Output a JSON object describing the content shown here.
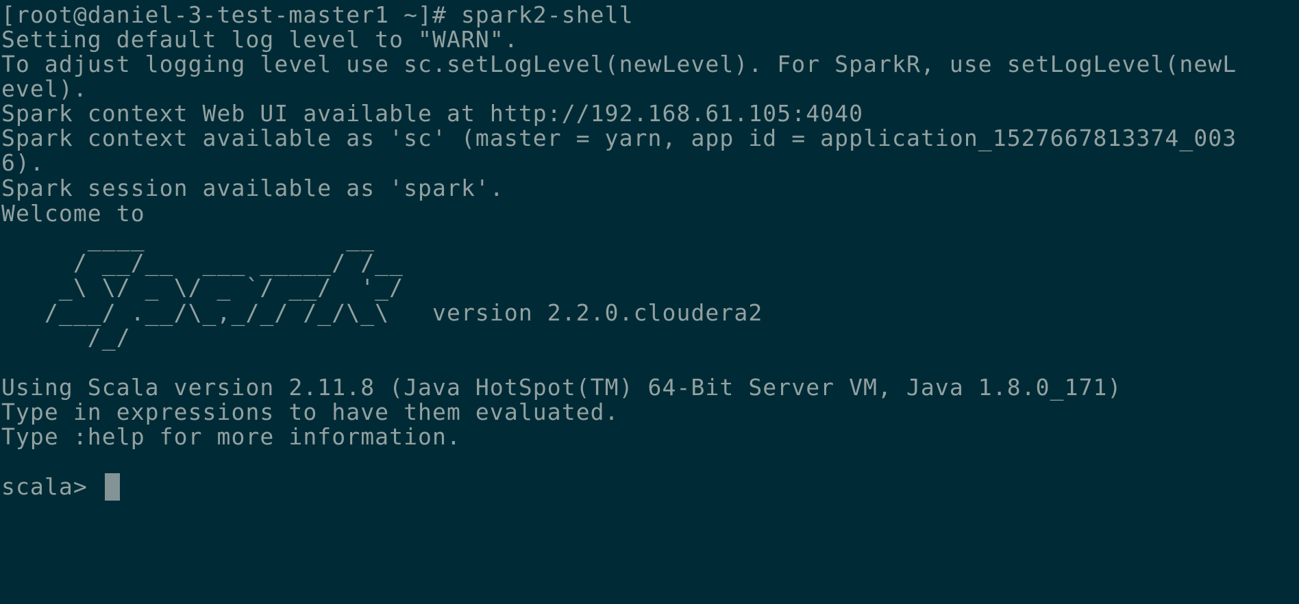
{
  "terminal": {
    "colors": {
      "background": "#002b36",
      "foreground": "#93a1a1",
      "cursor": "#839496"
    },
    "lines": [
      "[root@daniel-3-test-master1 ~]# spark2-shell",
      "Setting default log level to \"WARN\".",
      "To adjust logging level use sc.setLogLevel(newLevel). For SparkR, use setLogLevel(newL",
      "evel).",
      "Spark context Web UI available at http://192.168.61.105:4040",
      "Spark context available as 'sc' (master = yarn, app id = application_1527667813374_003",
      "6).",
      "Spark session available as 'spark'.",
      "Welcome to",
      "      ____              __",
      "     / __/__  ___ _____/ /__",
      "    _\\ \\/ _ \\/ _ `/ __/  '_/",
      "   /___/ .__/\\_,_/_/ /_/\\_\\   version 2.2.0.cloudera2",
      "      /_/",
      "",
      "Using Scala version 2.11.8 (Java HotSpot(TM) 64-Bit Server VM, Java 1.8.0_171)",
      "Type in expressions to have them evaluated.",
      "Type :help for more information.",
      ""
    ],
    "prompt": "scala> "
  }
}
